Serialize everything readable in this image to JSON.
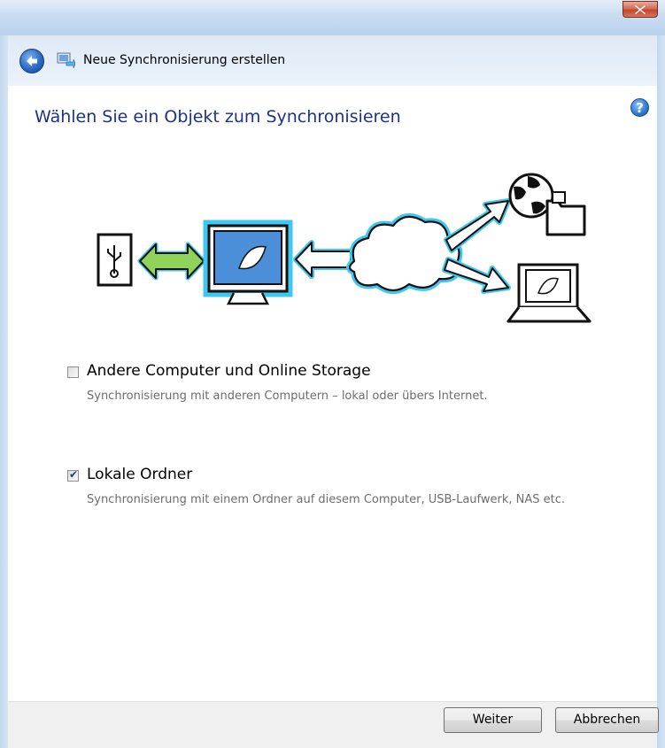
{
  "window": {
    "title": "Neue Synchronisierung erstellen",
    "close_label": "x"
  },
  "page": {
    "heading": "Wählen Sie ein Objekt zum Synchronisieren",
    "help": "?"
  },
  "options": [
    {
      "label": "Andere Computer und Online Storage",
      "description": "Synchronisierung mit anderen Computern – lokal oder übers Internet.",
      "checked": false
    },
    {
      "label": "Lokale Ordner",
      "description": "Synchronisierung mit einem Ordner auf diesem Computer, USB-Laufwerk, NAS etc.",
      "checked": true
    }
  ],
  "footer": {
    "next_label": "Weiter",
    "cancel_label": "Abbrechen"
  },
  "colors": {
    "heading": "#1e3287",
    "accent_cyan": "#3fc8ef",
    "arrow_green": "#8fd35a"
  },
  "icons": [
    "back-arrow-icon",
    "sync-app-icon",
    "help-icon",
    "usb-icon",
    "monitor-icon",
    "cloud-icon",
    "globe-icon",
    "folder-icon",
    "laptop-icon"
  ]
}
